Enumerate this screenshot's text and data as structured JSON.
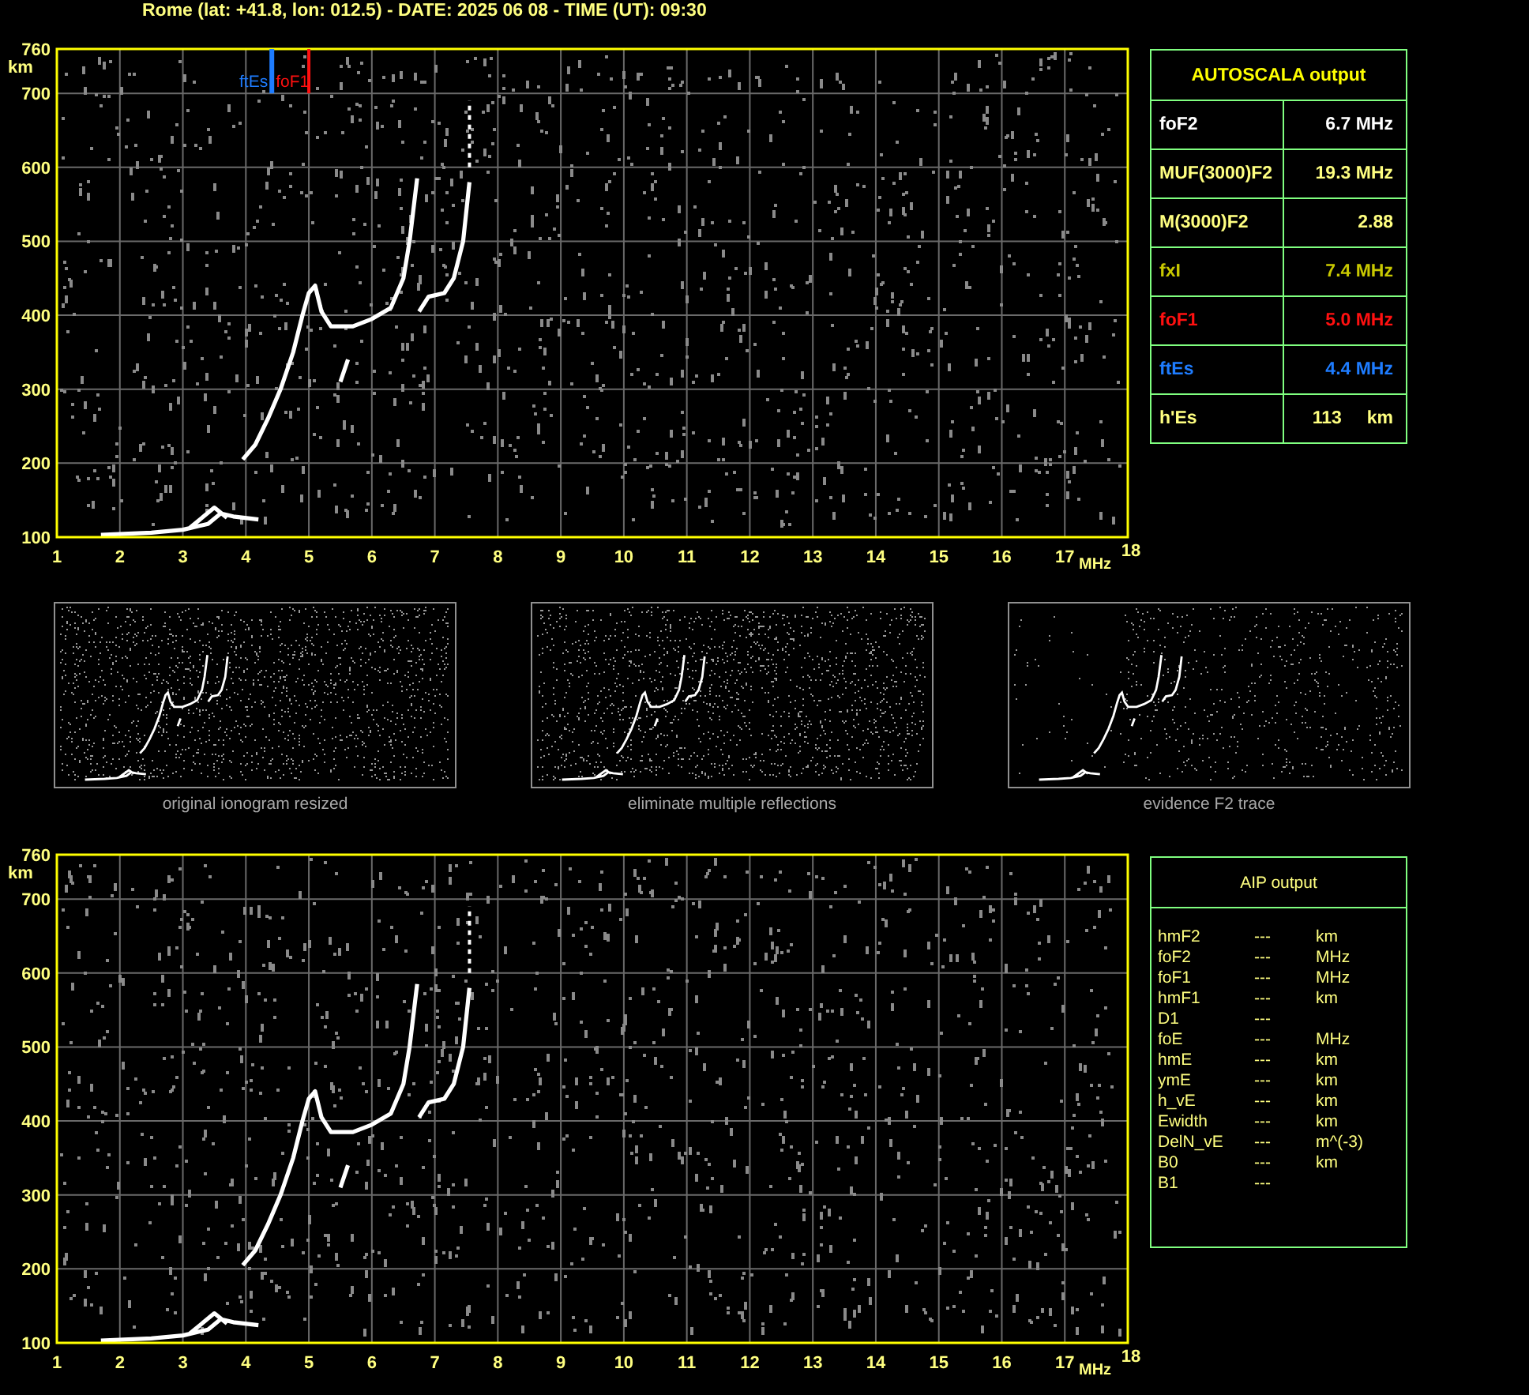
{
  "title": "Rome (lat: +41.8, lon: 012.5) - DATE: 2025 06 08 - TIME (UT): 09:30",
  "plots": [
    {
      "y_ticks": [
        "760",
        "700",
        "600",
        "500",
        "400",
        "300",
        "200",
        "100"
      ],
      "y_unit": "km",
      "x_ticks": [
        "1",
        "2",
        "3",
        "4",
        "5",
        "6",
        "7",
        "8",
        "9",
        "10",
        "11",
        "12",
        "13",
        "14",
        "15",
        "16",
        "17",
        "18"
      ],
      "x_unit": "MHz",
      "markers": [
        {
          "label": "ftEs",
          "color": "#1e7cff"
        },
        {
          "label": "foF1",
          "color": "#ff1010"
        }
      ]
    },
    {
      "y_ticks": [
        "760",
        "700",
        "600",
        "500",
        "400",
        "300",
        "200",
        "100"
      ],
      "y_unit": "km",
      "x_ticks": [
        "1",
        "2",
        "3",
        "4",
        "5",
        "6",
        "7",
        "8",
        "9",
        "10",
        "11",
        "12",
        "13",
        "14",
        "15",
        "16",
        "17",
        "18"
      ],
      "x_unit": "MHz"
    }
  ],
  "autoscala": {
    "title": "AUTOSCALA output",
    "rows": [
      {
        "name": "foF2",
        "value": "6.7 MHz",
        "color": "#ffffff"
      },
      {
        "name": "MUF(3000)F2",
        "value": "19.3 MHz",
        "color": "#ffff80"
      },
      {
        "name": "M(3000)F2",
        "value": "2.88",
        "color": "#ffff80"
      },
      {
        "name": "fxI",
        "value": "7.4 MHz",
        "color": "#c8c800"
      },
      {
        "name": "foF1",
        "value": "5.0 MHz",
        "color": "#ff1010"
      },
      {
        "name": "ftEs",
        "value": "4.4 MHz",
        "color": "#1e7cff"
      },
      {
        "name": "h'Es",
        "value": "113",
        "unit": "km",
        "color": "#ffff80"
      }
    ]
  },
  "thumbnails": [
    {
      "caption": "original ionogram resized"
    },
    {
      "caption": "eliminate multiple reflections"
    },
    {
      "caption": "evidence F2 trace"
    }
  ],
  "aip": {
    "title": "AIP output",
    "rows": [
      {
        "name": "hmF2",
        "value": "---",
        "unit": "km"
      },
      {
        "name": "foF2",
        "value": "---",
        "unit": "MHz"
      },
      {
        "name": "foF1",
        "value": "---",
        "unit": "MHz"
      },
      {
        "name": "hmF1",
        "value": "---",
        "unit": "km"
      },
      {
        "name": "D1",
        "value": "---"
      },
      {
        "name": "foE",
        "value": "---",
        "unit": "MHz"
      },
      {
        "name": "hmE",
        "value": "---",
        "unit": "km"
      },
      {
        "name": "ymE",
        "value": "---",
        "unit": "km"
      },
      {
        "name": "h_vE",
        "value": "---",
        "unit": "km"
      },
      {
        "name": "Ewidth",
        "value": "---",
        "unit": "km"
      },
      {
        "name": "DelN_vE",
        "value": "---",
        "unit": "m^(-3)"
      },
      {
        "name": "B0",
        "value": "---",
        "unit": "km"
      },
      {
        "name": "B1",
        "value": "---"
      }
    ]
  }
}
